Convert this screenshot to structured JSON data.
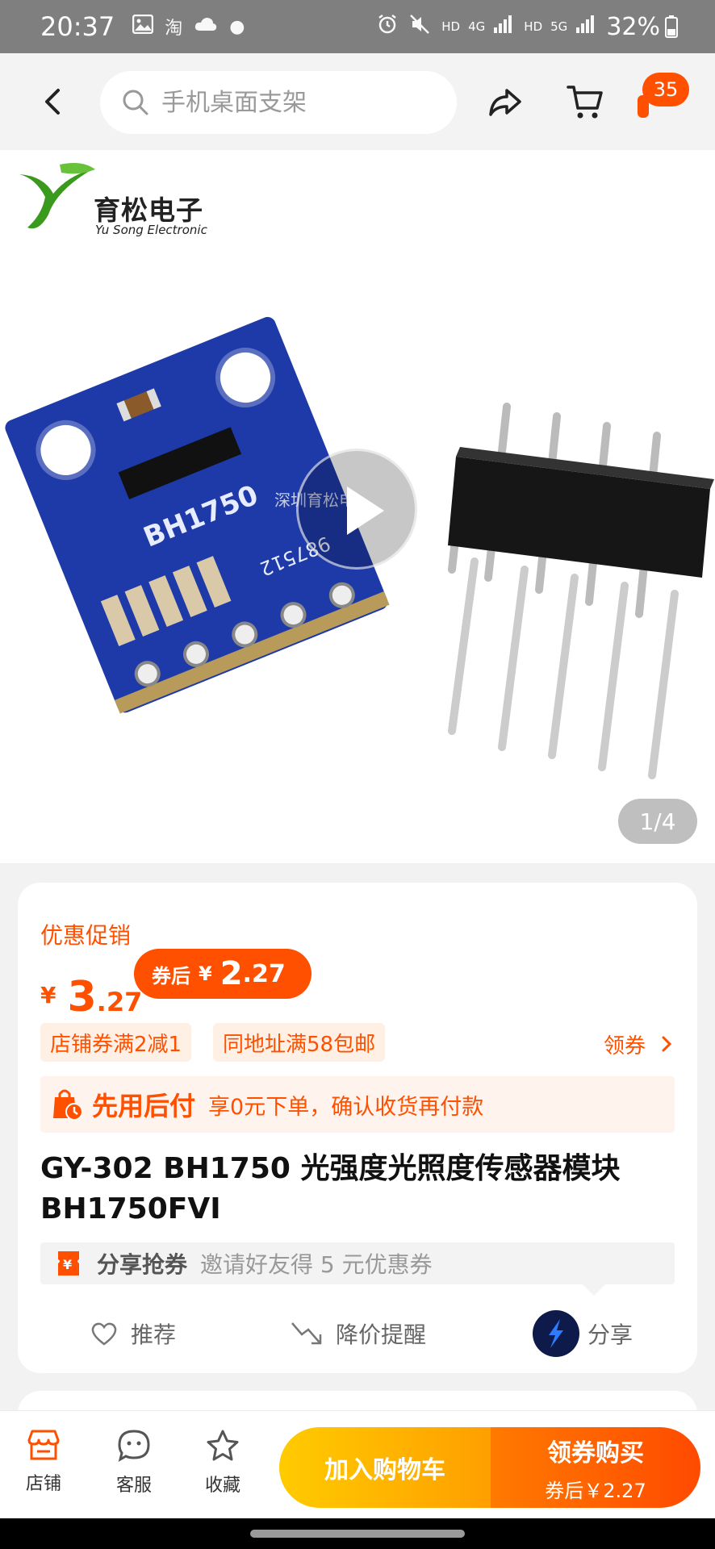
{
  "status_bar": {
    "time": "20:37",
    "app_icon_text": "淘",
    "hd1": "HD",
    "net1": "4G",
    "hd2": "HD",
    "net2": "5G",
    "battery": "32%"
  },
  "nav": {
    "search_placeholder": "手机桌面支架",
    "message_count": "35"
  },
  "gallery": {
    "logo_cn": "育松电子",
    "logo_en": "Yu Song Electronic",
    "watermark": "深圳育松电子",
    "page_indicator": "1/4"
  },
  "promo": {
    "label": "优惠促销",
    "currency": "¥",
    "price_int": "3",
    "price_dec": ".27",
    "after_label": "券后",
    "after_currency": "¥",
    "after_int": "2",
    "after_dec": ".27"
  },
  "coupons": {
    "chip1": "店铺券满2减1",
    "chip2": "同地址满58包邮",
    "get_label": "领券"
  },
  "pay_later": {
    "title": "先用后付",
    "desc": "享0元下单，确认收货再付款"
  },
  "product": {
    "title_line1": "GY-302 BH1750 光强度光照度传感器模块",
    "title_line2": "BH1750FVI"
  },
  "share_coupon": {
    "title": "分享抢券",
    "desc": "邀请好友得 5 元优惠券"
  },
  "actions": {
    "recommend": "推荐",
    "price_alert": "降价提醒",
    "share": "分享"
  },
  "bottom": {
    "store": "店铺",
    "service": "客服",
    "favorite": "收藏",
    "add_cart": "加入购物车",
    "buy_main": "领券购买",
    "buy_sub": "券后￥2.27"
  },
  "colors": {
    "accent": "#ff5000",
    "cart_button": "#ffb300",
    "pcb_blue": "#1f3fa8"
  }
}
